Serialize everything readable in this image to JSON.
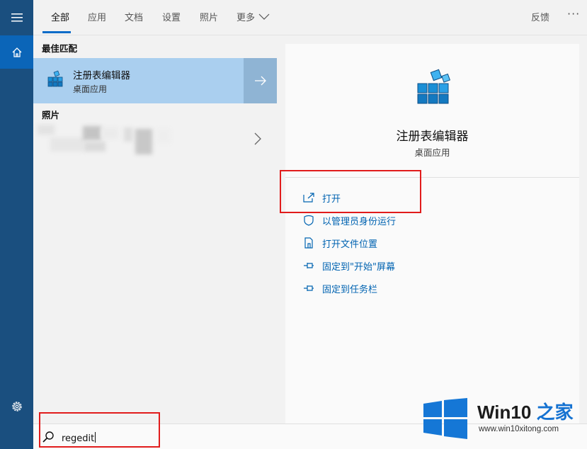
{
  "tabs": [
    {
      "label": "全部",
      "active": true
    },
    {
      "label": "应用"
    },
    {
      "label": "文档"
    },
    {
      "label": "设置"
    },
    {
      "label": "照片"
    },
    {
      "label": "更多"
    }
  ],
  "topbar": {
    "feedback": "反馈",
    "more_dots": "···"
  },
  "left": {
    "best_match_label": "最佳匹配",
    "best_match": {
      "title": "注册表编辑器",
      "subtitle": "桌面应用",
      "icon": "registry-editor-icon"
    },
    "photos_label": "照片"
  },
  "right": {
    "app_title": "注册表编辑器",
    "app_subtitle": "桌面应用",
    "actions": [
      {
        "label": "打开",
        "icon": "open-icon"
      },
      {
        "label": "以管理员身份运行",
        "icon": "shield-icon"
      },
      {
        "label": "打开文件位置",
        "icon": "file-location-icon"
      },
      {
        "label": "固定到\"开始\"屏幕",
        "icon": "pin-icon"
      },
      {
        "label": "固定到任务栏",
        "icon": "pin-icon"
      }
    ]
  },
  "search": {
    "value": "regedit",
    "icon": "search-icon"
  },
  "watermark": {
    "brand_main": "Win10",
    "brand_accent": " 之家",
    "url": "www.win10xitong.com"
  },
  "colors": {
    "sidebar": "#1a4f7f",
    "accent": "#0b6cc8",
    "selection": "#aacfef",
    "link": "#0063b1",
    "highlight": "#e11c1c"
  }
}
